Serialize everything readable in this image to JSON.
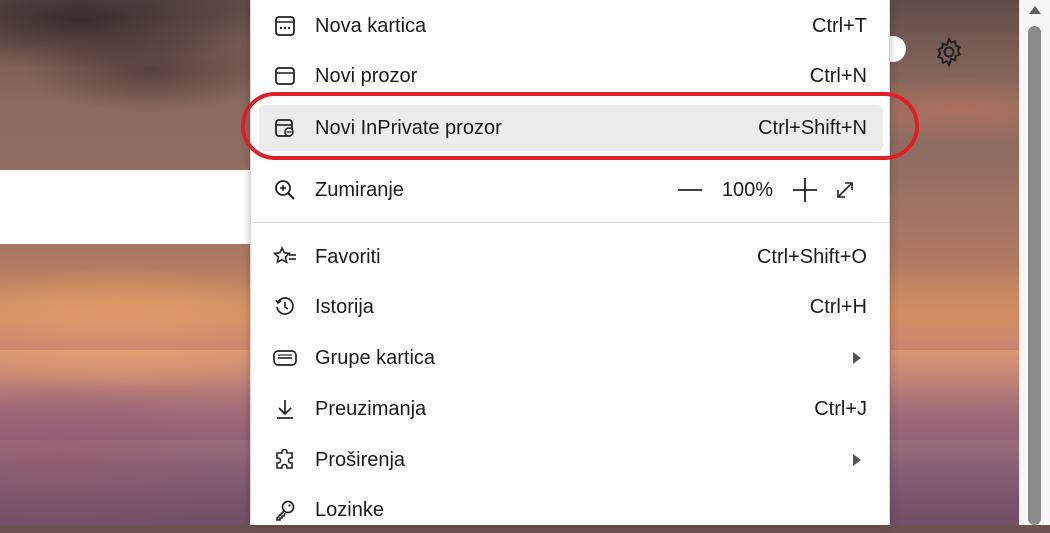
{
  "menu": {
    "items": [
      {
        "label": "Nova kartica",
        "shortcut": "Ctrl+T",
        "icon": "new-tab-icon"
      },
      {
        "label": "Novi prozor",
        "shortcut": "Ctrl+N",
        "icon": "new-window-icon"
      },
      {
        "label": "Novi InPrivate prozor",
        "shortcut": "Ctrl+Shift+N",
        "icon": "inprivate-icon",
        "highlighted": true
      },
      {
        "label": "Zumiranje",
        "zoom": "100%",
        "icon": "zoom-icon"
      },
      {
        "label": "Favoriti",
        "shortcut": "Ctrl+Shift+O",
        "icon": "favorites-icon"
      },
      {
        "label": "Istorija",
        "shortcut": "Ctrl+H",
        "icon": "history-icon"
      },
      {
        "label": "Grupe kartica",
        "submenu": true,
        "icon": "tab-groups-icon"
      },
      {
        "label": "Preuzimanja",
        "shortcut": "Ctrl+J",
        "icon": "download-icon"
      },
      {
        "label": "Proširenja",
        "submenu": true,
        "icon": "extensions-icon"
      },
      {
        "label": "Lozinke",
        "icon": "key-icon"
      }
    ]
  },
  "annotation": {
    "color": "#e01e26"
  },
  "colors": {
    "highlight": "#ececec",
    "menu_bg": "#ffffff"
  }
}
